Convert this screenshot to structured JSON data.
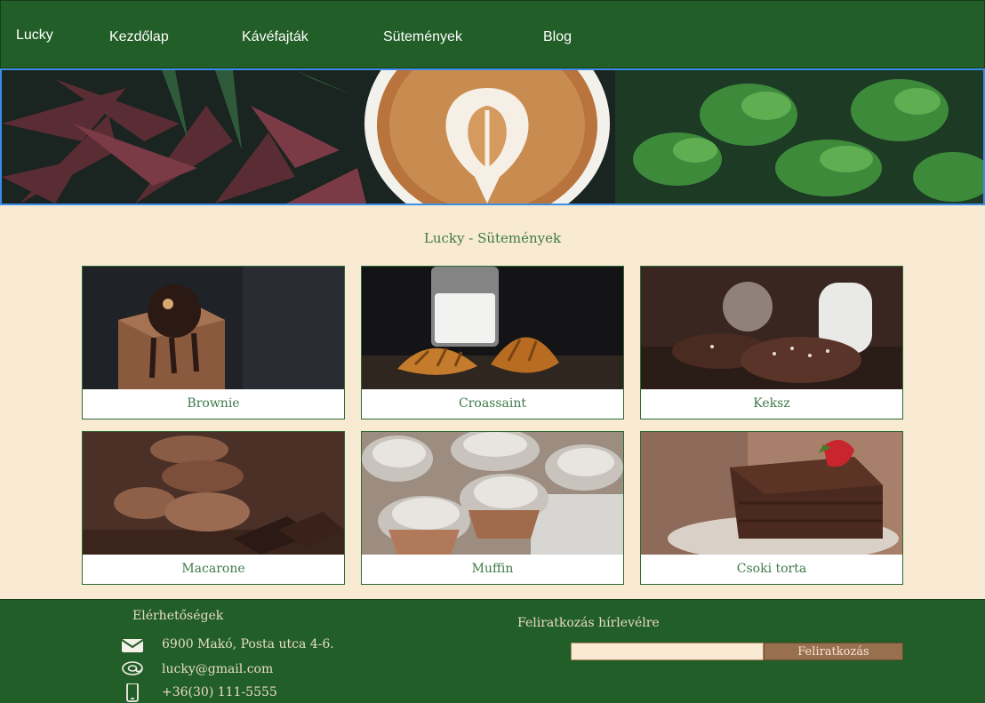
{
  "nav": {
    "brand": "Lucky",
    "links": [
      "Kezdőlap",
      "Kávéfajták",
      "Sütemények",
      "Blog"
    ]
  },
  "hero": {
    "image": "latte-art-coffee-with-plants"
  },
  "section": {
    "title": "Lucky - Sütemények"
  },
  "products": [
    {
      "label": "Brownie",
      "image": "chocolate-brownie"
    },
    {
      "label": "Croassaint",
      "image": "croissants-with-milk"
    },
    {
      "label": "Keksz",
      "image": "chocolate-cookies-with-milk"
    },
    {
      "label": "Macarone",
      "image": "chocolate-macarons"
    },
    {
      "label": "Muffin",
      "image": "sugar-dusted-muffins"
    },
    {
      "label": "Csoki torta",
      "image": "chocolate-cake-with-strawberry"
    }
  ],
  "footer": {
    "contact_title": "Elérhetőségek",
    "address": "6900 Makó, Posta utca 4-6.",
    "email": "lucky@gmail.com",
    "phone": "+36(30) 111-5555",
    "address_icon": "envelope-icon",
    "email_icon": "at-sign-icon",
    "phone_icon": "phone-icon",
    "newsletter_title": "Feliratkozás hírlevélre",
    "newsletter_placeholder": "",
    "subscribe_label": "Feliratkozás"
  },
  "colors": {
    "nav_bg": "#225e27",
    "page_bg": "#f9ead4",
    "accent_text": "#3d7a49",
    "button_bg": "#99704f"
  }
}
